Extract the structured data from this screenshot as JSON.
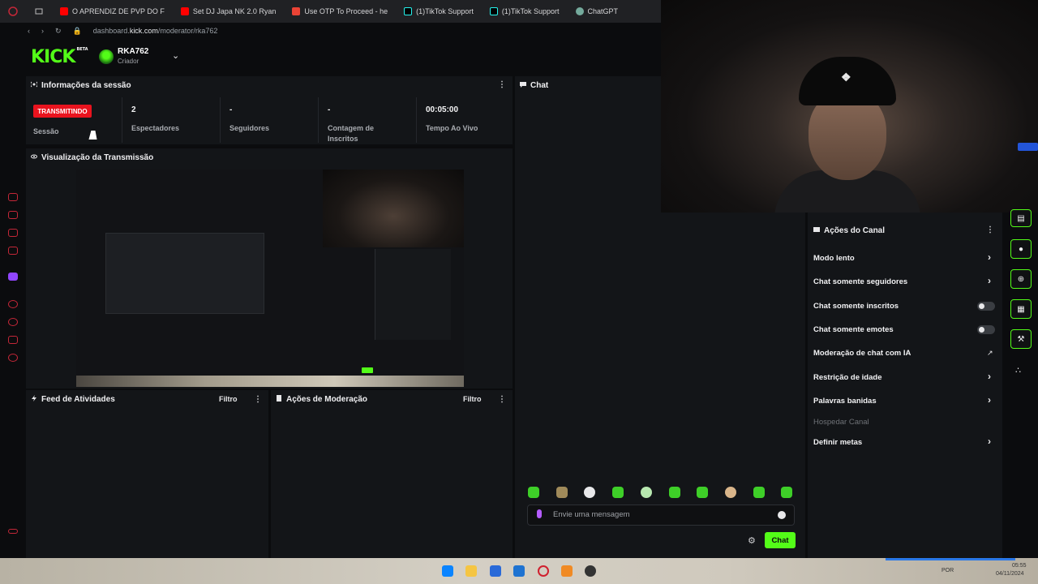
{
  "browser": {
    "tabs": [
      {
        "label": "O APRENDIZ DE PVP DO F",
        "color": "#ff0000"
      },
      {
        "label": "Set DJ Japa NK 2.0 Ryan",
        "color": "#ff0000"
      },
      {
        "label": "Use OTP To Proceed - he",
        "color": "#ea4335"
      },
      {
        "label": "(1)TikTok Support",
        "color": "#000000"
      },
      {
        "label": "(1)TikTok Support",
        "color": "#000000"
      },
      {
        "label": "ChatGPT",
        "color": "#74aa9c"
      }
    ],
    "url_prefix": "dashboard.",
    "url_domain": "kick.com",
    "url_path": "/moderator/rka762"
  },
  "header": {
    "logo": "KICK",
    "logo_badge": "BETA",
    "username": "RKA762",
    "role": "Criador"
  },
  "session": {
    "title": "Informações da sessão",
    "badge": "TRANSMITINDO",
    "session_label": "Sessão",
    "stats": [
      {
        "value": "2",
        "label": "Espectadores"
      },
      {
        "value": "-",
        "label": "Seguidores"
      },
      {
        "value": "-",
        "label": "Contagem de Inscritos"
      },
      {
        "value": "00:05:00",
        "label": "Tempo Ao Vivo"
      }
    ]
  },
  "preview": {
    "title": "Visualização da Transmissão"
  },
  "activity": {
    "title": "Feed de Atividades",
    "filter": "Filtro"
  },
  "moderation": {
    "title": "Ações de Moderação",
    "filter": "Filtro"
  },
  "chat": {
    "title": "Chat",
    "placeholder": "Envie uma mensagem",
    "send_label": "Chat"
  },
  "canal": {
    "title": "Ações do Canal",
    "items": [
      {
        "label": "Modo lento",
        "control": "chevron"
      },
      {
        "label": "Chat somente seguidores",
        "control": "chevron"
      },
      {
        "label": "Chat somente inscritos",
        "control": "toggle"
      },
      {
        "label": "Chat somente emotes",
        "control": "toggle"
      },
      {
        "label": "Moderação de chat com IA",
        "control": "external"
      },
      {
        "label": "Restrição de idade",
        "control": "chevron"
      },
      {
        "label": "Palavras banidas",
        "control": "chevron"
      },
      {
        "label": "Hospedar Canal",
        "control": "none"
      },
      {
        "label": "Definir metas",
        "control": "chevron"
      }
    ]
  },
  "taskbar": {
    "lang": "POR",
    "time": "05:55",
    "date": "04/11/2024"
  },
  "colors": {
    "accent": "#53fc18",
    "live": "#e9131e",
    "panel": "#131518"
  }
}
